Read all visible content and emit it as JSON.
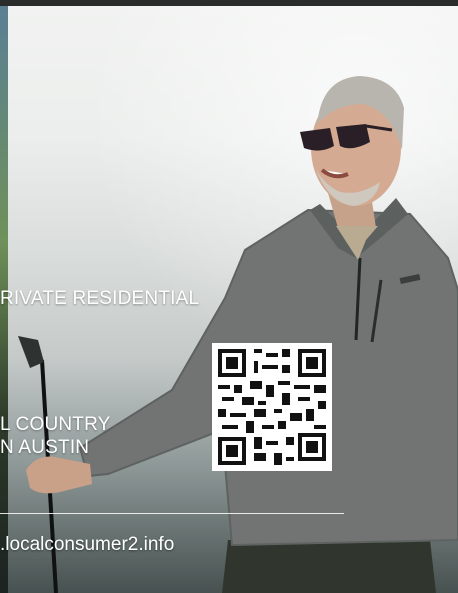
{
  "ad": {
    "line1": "RIVATE RESIDENTIAL",
    "line2": "L COUNTRY",
    "line3": "N AUSTIN",
    "url": ".localconsumer2.info"
  },
  "qr": {
    "icon": "qr-code-icon"
  },
  "colors": {
    "text": "#ffffff",
    "background_top": "#f1f2f1",
    "sweater": "#6e7170"
  }
}
